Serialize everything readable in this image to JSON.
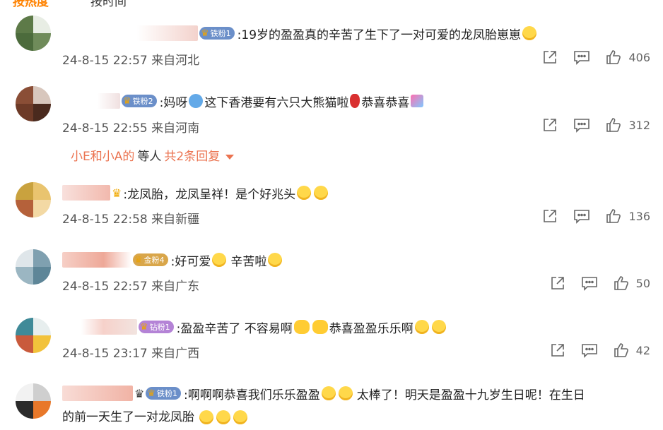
{
  "tabs": {
    "hot": "按热度",
    "time": "按时间"
  },
  "comments": [
    {
      "badge": "铁粉1",
      "text": ":19岁的盈盈真的辛苦了生下了一对可爱的龙凤胎崽崽",
      "time": "24-8-15 22:57",
      "location": "来自河北",
      "likes": "406"
    },
    {
      "badge": "铁粉2",
      "text_a": ":妈呀",
      "text_b": "这下香港要有六只大熊猫啦",
      "text_c": "恭喜恭喜",
      "time": "24-8-15 22:55",
      "location": "来自河南",
      "likes": "312"
    },
    {
      "text": ":龙凤胎，龙凤呈祥！是个好兆头",
      "time": "24-8-15 22:58",
      "location": "来自新疆",
      "likes": "136"
    },
    {
      "badge": "金粉4",
      "text_a": ":好可爱",
      "text_b": "辛苦啦",
      "time": "24-8-15 22:57",
      "location": "来自广东",
      "likes": "50"
    },
    {
      "badge": "钻粉1",
      "text_a": ":盈盈辛苦了 不容易啊",
      "text_b": "恭喜盈盈乐乐啊",
      "time": "24-8-15 23:17",
      "location": "来自广西",
      "likes": "42"
    },
    {
      "badge": "铁粉1",
      "text_a": ":啊啊啊恭喜我们乐乐盈盈",
      "text_b": "太棒了！明天是盈盈十九岁生日呢！在生日",
      "text_c": "的前一天生了一对龙凤胎"
    }
  ],
  "reply_summary": {
    "who": "小E和小A的",
    "plain": "等人",
    "count": "共2条回复"
  },
  "colors": {
    "accent": "#ff8200",
    "link": "#eb7350"
  }
}
